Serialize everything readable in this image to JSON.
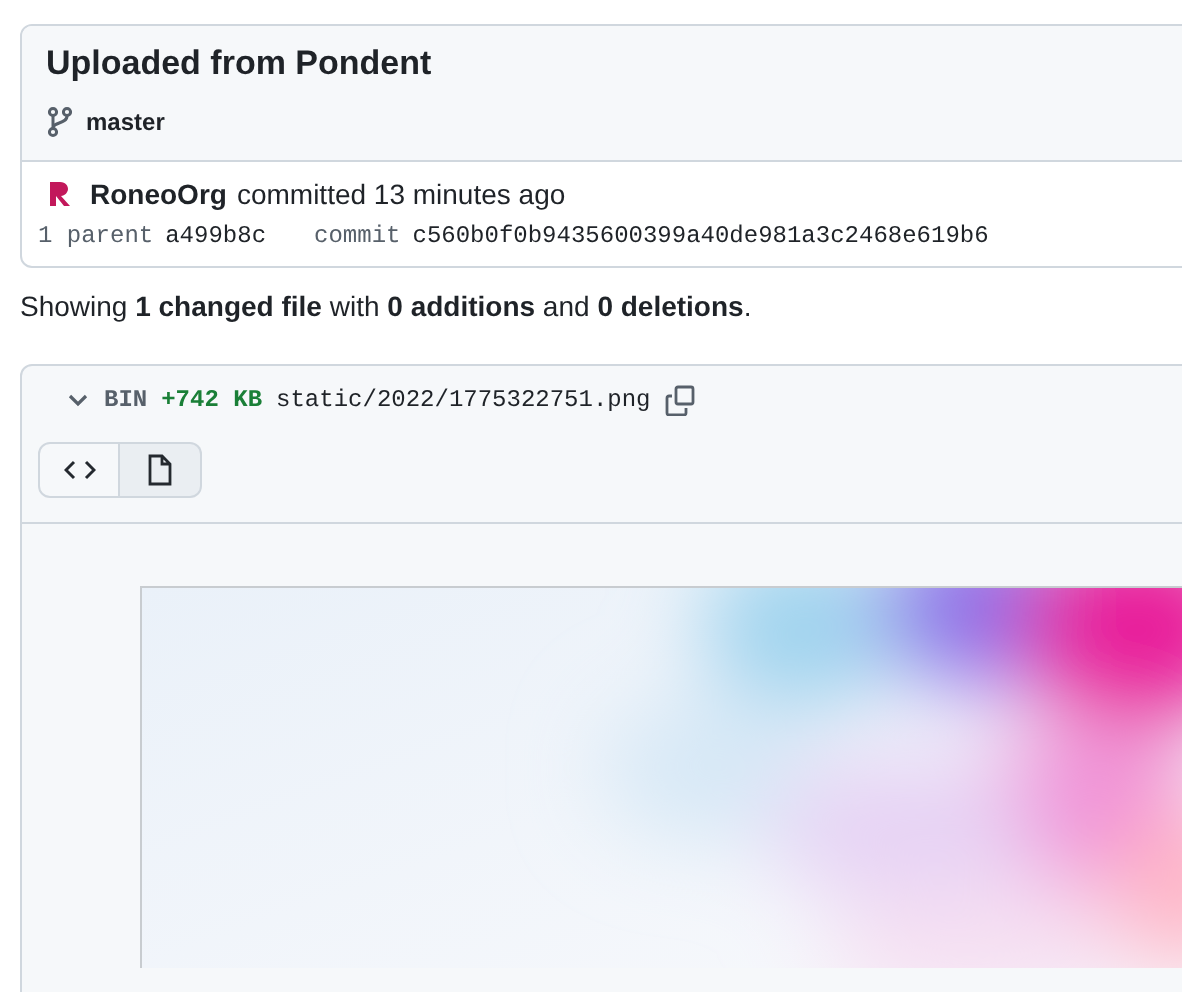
{
  "commit": {
    "title": "Uploaded from Pondent",
    "branch": "master",
    "author": "RoneoOrg",
    "action": "committed 13 minutes ago",
    "parent_label": "1 parent",
    "parent_hash": "a499b8c",
    "commit_label": "commit",
    "commit_hash": "c560b0f0b9435600399a40de981a3c2468e619b6"
  },
  "summary": "Showing **1 changed file** with **0 additions** and **0 deletions**.",
  "file": {
    "expanded": true,
    "type": "BIN",
    "size": "+742 KB",
    "path": "static/2022/1775322751.png",
    "view_buttons": [
      {
        "kind": "code",
        "selected": false
      },
      {
        "kind": "file",
        "selected": true
      }
    ]
  }
}
